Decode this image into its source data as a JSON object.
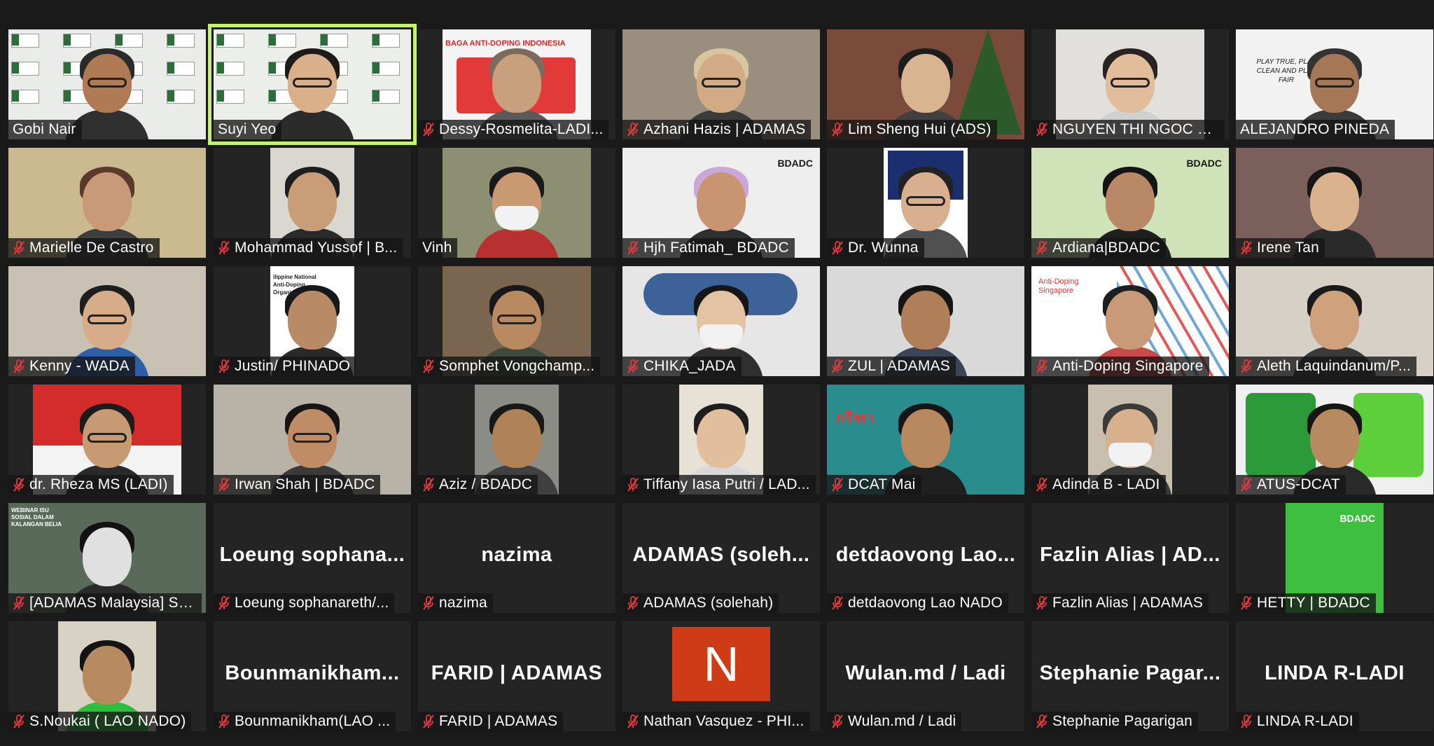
{
  "participants": [
    {
      "name": "Gobi Nair",
      "muted": false,
      "video": true,
      "bg": "#e9ece8",
      "skin": "#b07a55",
      "hair": "#2a2a2a",
      "shirt": "#303030",
      "glasses": true,
      "vw": 141,
      "decor": "sea"
    },
    {
      "name": "Suyi Yeo",
      "muted": false,
      "video": true,
      "bg": "#eceee9",
      "skin": "#d9b08a",
      "hair": "#1e1a18",
      "shirt": "#2b2b2b",
      "glasses": true,
      "vw": 141,
      "decor": "sea",
      "active": true
    },
    {
      "name": "Dessy-Rosmelita-LADI...",
      "muted": true,
      "video": true,
      "bg": "#f4f4f4",
      "skin": "#c8a07e",
      "hair": "#7c6a5e",
      "shirt": "#5a5a5a",
      "glasses": false,
      "vw": 106,
      "decor": "ladi",
      "sign": "BAGA ANTI-DOPING INDONESIA"
    },
    {
      "name": "Azhani Hazis | ADAMAS",
      "muted": true,
      "video": true,
      "bg": "#9a8f7e",
      "skin": "#d3aa86",
      "hair": "#d8c6a0",
      "shirt": "#3a3a3a",
      "glasses": true,
      "vw": 141
    },
    {
      "name": "Lim Sheng Hui (ADS)",
      "muted": true,
      "video": true,
      "bg": "#7a4a3a",
      "skin": "#d9b490",
      "hair": "#1c1c1c",
      "shirt": "#404040",
      "glasses": false,
      "vw": 141,
      "decor": "xmas"
    },
    {
      "name": "NGUYEN THI NGOC LY...",
      "muted": true,
      "video": true,
      "bg": "#e2e0dc",
      "skin": "#e2bd9c",
      "hair": "#2a2222",
      "shirt": "#d0d0d0",
      "glasses": true,
      "vw": 106
    },
    {
      "name": "ALEJANDRO PINEDA",
      "muted": false,
      "video": true,
      "bg": "#f2f2f2",
      "skin": "#a67756",
      "hair": "#333333",
      "shirt": "#3b3b3b",
      "glasses": true,
      "vw": 141,
      "decor": "play",
      "sign": "PLAY TRUE, PLAY CLEAN AND PLAY FAIR"
    },
    {
      "name": "Marielle De Castro",
      "muted": true,
      "video": true,
      "bg": "#cbb98f",
      "skin": "#c89a78",
      "hair": "#5a3a2a",
      "shirt": "#3e3e3e",
      "glasses": false,
      "vw": 141
    },
    {
      "name": "Mohammad Yussof | B...",
      "muted": true,
      "video": true,
      "bg": "#dad6d0",
      "skin": "#c99d78",
      "hair": "#1e1e1e",
      "shirt": "#2a2a2a",
      "glasses": false,
      "vw": 60
    },
    {
      "name": "Vinh",
      "muted": false,
      "video": true,
      "bg": "#8d8f72",
      "skin": "#c99a72",
      "hair": "#1a1a1a",
      "shirt": "#b83030",
      "glasses": false,
      "mask": true,
      "vw": 106
    },
    {
      "name": "Hjh Fatimah_ BDADC",
      "muted": true,
      "video": true,
      "bg": "#eeeeee",
      "skin": "#c89570",
      "hair": "#c9a8d8",
      "shirt": "#2f2f2f",
      "glasses": false,
      "vw": 141,
      "decor": "bdadc",
      "sign": "BDADC"
    },
    {
      "name": "Dr. Wunna",
      "muted": true,
      "video": true,
      "bg": "#ffffff",
      "skin": "#d8b090",
      "hair": "#222222",
      "shirt": "#505050",
      "glasses": true,
      "vw": 60,
      "decor": "ai"
    },
    {
      "name": "Ardiana|BDADC",
      "muted": true,
      "video": true,
      "bg": "#cfe2b8",
      "skin": "#b98866",
      "hair": "#151515",
      "shirt": "#1f1f1f",
      "glasses": false,
      "vw": 141,
      "decor": "bdadc",
      "sign": "BDADC"
    },
    {
      "name": "Irene Tan",
      "muted": true,
      "video": true,
      "bg": "#7a5f5a",
      "skin": "#dbb28e",
      "hair": "#161616",
      "shirt": "#2a2a2a",
      "glasses": false,
      "vw": 141
    },
    {
      "name": "Kenny - WADA",
      "muted": true,
      "video": true,
      "bg": "#c9c2b4",
      "skin": "#d6ad88",
      "hair": "#1e1e1e",
      "shirt": "#2d5ea8",
      "glasses": true,
      "vw": 141
    },
    {
      "name": "Justin/ PHINADO",
      "muted": true,
      "video": true,
      "bg": "#ffffff",
      "skin": "#b88a66",
      "hair": "#181818",
      "shirt": "#2a2a2a",
      "glasses": false,
      "vw": 60,
      "decor": "phinado",
      "sign": "ilippine National Anti-Doping Organization"
    },
    {
      "name": "Somphet Vongchamp...",
      "muted": true,
      "video": true,
      "bg": "#7a6650",
      "skin": "#b98a62",
      "hair": "#181818",
      "shirt": "#3d4a3d",
      "glasses": true,
      "vw": 106
    },
    {
      "name": "CHIKA_JADA",
      "muted": true,
      "video": true,
      "bg": "#e6e6e6",
      "skin": "#e4c2a4",
      "hair": "#161616",
      "shirt": "#2f2f2f",
      "glasses": false,
      "mask": true,
      "vw": 141,
      "decor": "jada"
    },
    {
      "name": "ZUL | ADAMAS",
      "muted": true,
      "video": true,
      "bg": "#d9d9d9",
      "skin": "#b07e58",
      "hair": "#151515",
      "shirt": "#3a4658",
      "glasses": false,
      "vw": 141
    },
    {
      "name": "Anti-Doping Singapore",
      "muted": true,
      "video": true,
      "bg": "#ffffff",
      "skin": "#c99a78",
      "hair": "#1e1e1e",
      "shirt": "#c84a4a",
      "glasses": false,
      "vw": 141,
      "decor": "ads",
      "sign": "Anti-Doping Singapore"
    },
    {
      "name": "Aleth Laquindanum/P...",
      "muted": true,
      "video": true,
      "bg": "#d6d0c6",
      "skin": "#cfa17c",
      "hair": "#1a1a1a",
      "shirt": "#3a3a3a",
      "glasses": false,
      "vw": 141
    },
    {
      "name": "dr. Rheza MS (LADI)",
      "muted": true,
      "video": true,
      "bg": "#d42b2b",
      "skin": "#c79a74",
      "hair": "#1c1c1c",
      "shirt": "#2a2a2a",
      "glasses": true,
      "vw": 106,
      "decor": "flag"
    },
    {
      "name": "Irwan Shah | BDADC",
      "muted": true,
      "video": true,
      "bg": "#b9b2a6",
      "skin": "#c08c66",
      "hair": "#151515",
      "shirt": "#3a3a3a",
      "glasses": true,
      "vw": 141
    },
    {
      "name": "Aziz / BDADC",
      "muted": true,
      "video": true,
      "bg": "#8c8c86",
      "skin": "#b08258",
      "hair": "#181818",
      "shirt": "#404040",
      "glasses": false,
      "vw": 60
    },
    {
      "name": "Tiffany Iasa Putri / LAD...",
      "muted": true,
      "video": true,
      "bg": "#e8e2d6",
      "skin": "#e2bf9c",
      "hair": "#1e1e1e",
      "shirt": "#d9d9d9",
      "glasses": false,
      "vw": 60
    },
    {
      "name": "DCAT Mai",
      "muted": true,
      "video": true,
      "bg": "#2a8c8c",
      "skin": "#b8885e",
      "hair": "#151515",
      "shirt": "#202020",
      "glasses": false,
      "vw": 141,
      "decor": "thai",
      "sign": "กรีฑา"
    },
    {
      "name": "Adinda B - LADI",
      "muted": true,
      "video": true,
      "bg": "#c9bfae",
      "skin": "#d7b08d",
      "hair": "#3a3a3a",
      "shirt": "#3a3a3a",
      "glasses": false,
      "mask": true,
      "vw": 60
    },
    {
      "name": "ATUS-DCAT",
      "muted": true,
      "video": true,
      "bg": "#efefef",
      "skin": "#b88a60",
      "hair": "#151515",
      "shirt": "#2a2a2a",
      "glasses": false,
      "vw": 141,
      "decor": "jerseys"
    },
    {
      "name": "[ADAMAS Malaysia] Sy...",
      "muted": true,
      "video": true,
      "bg": "#5a6a5a",
      "skin": "#e0e0e0",
      "hair": "#121212",
      "shirt": "#2a2a2a",
      "glasses": false,
      "vw": 141,
      "decor": "webinar",
      "sign": "WEBINAR ISU SOSIAL DALAM KALANGAN BELIA"
    },
    {
      "name": "Loeung sophanareth/...",
      "muted": true,
      "video": false,
      "display": "Loeung  sophana..."
    },
    {
      "name": "nazima",
      "muted": true,
      "video": false,
      "display": "nazima"
    },
    {
      "name": "ADAMAS (solehah)",
      "muted": true,
      "video": false,
      "display": "ADAMAS  (soleh..."
    },
    {
      "name": "detdaovong Lao NADO",
      "muted": true,
      "video": false,
      "display": "detdaovong  Lao..."
    },
    {
      "name": "Fazlin Alias | ADAMAS",
      "muted": true,
      "video": false,
      "display": "Fazlin Alias | AD..."
    },
    {
      "name": "HETTY | BDADC",
      "muted": true,
      "video": true,
      "bg": "#3fbf3f",
      "vw": 70,
      "decor": "hetty",
      "sign": "BDADC"
    },
    {
      "name": "S.Noukai ( LAO NADO)",
      "muted": true,
      "video": true,
      "bg": "#d8d2c4",
      "skin": "#b78a60",
      "hair": "#141414",
      "shirt": "#2cbf3a",
      "glasses": false,
      "vw": 70
    },
    {
      "name": "Bounmanikham(LAO ...",
      "muted": true,
      "video": false,
      "display": "Bounmanikham..."
    },
    {
      "name": "FARID | ADAMAS",
      "muted": true,
      "video": false,
      "display": "FARID | ADAMAS"
    },
    {
      "name": "Nathan Vasquez - PHI...",
      "muted": true,
      "video": false,
      "avatar": "N",
      "avatar_color": "#cf3b17"
    },
    {
      "name": "Wulan.md / Ladi",
      "muted": true,
      "video": false,
      "display": "Wulan.md / Ladi"
    },
    {
      "name": "Stephanie Pagarigan",
      "muted": true,
      "video": false,
      "display": "Stephanie  Pagar..."
    },
    {
      "name": "LINDA R-LADI",
      "muted": true,
      "video": false,
      "display": "LINDA R-LADI"
    }
  ],
  "colors": {
    "background": "#1a1a1a",
    "tile": "#242424",
    "active_border": "#c6f26a",
    "mute_icon": "#e0393e"
  }
}
